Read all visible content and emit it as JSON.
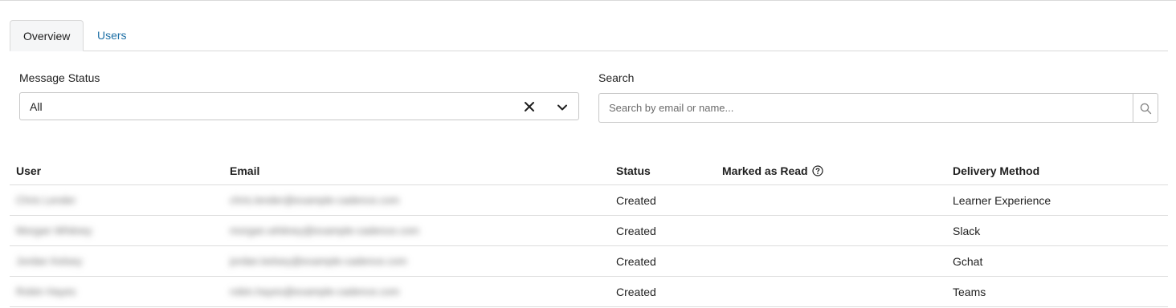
{
  "tabs": [
    {
      "label": "Overview",
      "active": true
    },
    {
      "label": "Users",
      "active": false
    }
  ],
  "filters": {
    "message_status": {
      "label": "Message Status",
      "value": "All"
    },
    "search": {
      "label": "Search",
      "placeholder": "Search by email or name...",
      "value": ""
    }
  },
  "table": {
    "columns": [
      "User",
      "Email",
      "Status",
      "Marked as Read",
      "Delivery Method"
    ],
    "rows": [
      {
        "user": "Chris Lender",
        "email": "chris.lender@example-cadence.com",
        "status": "Created",
        "read": "",
        "delivery": "Learner Experience"
      },
      {
        "user": "Morgan Whitney",
        "email": "morgan.whitney@example-cadence.com",
        "status": "Created",
        "read": "",
        "delivery": "Slack"
      },
      {
        "user": "Jordan Kelsey",
        "email": "jordan.kelsey@example-cadence.com",
        "status": "Created",
        "read": "",
        "delivery": "Gchat"
      },
      {
        "user": "Robin Hayes",
        "email": "robin.hayes@example-cadence.com",
        "status": "Created",
        "read": "",
        "delivery": "Teams"
      }
    ]
  },
  "icons": {
    "clear": "close-icon",
    "dropdown": "chevron-down-icon",
    "search": "search-icon",
    "help": "question-circle-icon"
  },
  "colors": {
    "link": "#1d6fa5",
    "border": "#d9d9d9",
    "tab_active_bg": "#f5f6f7"
  }
}
